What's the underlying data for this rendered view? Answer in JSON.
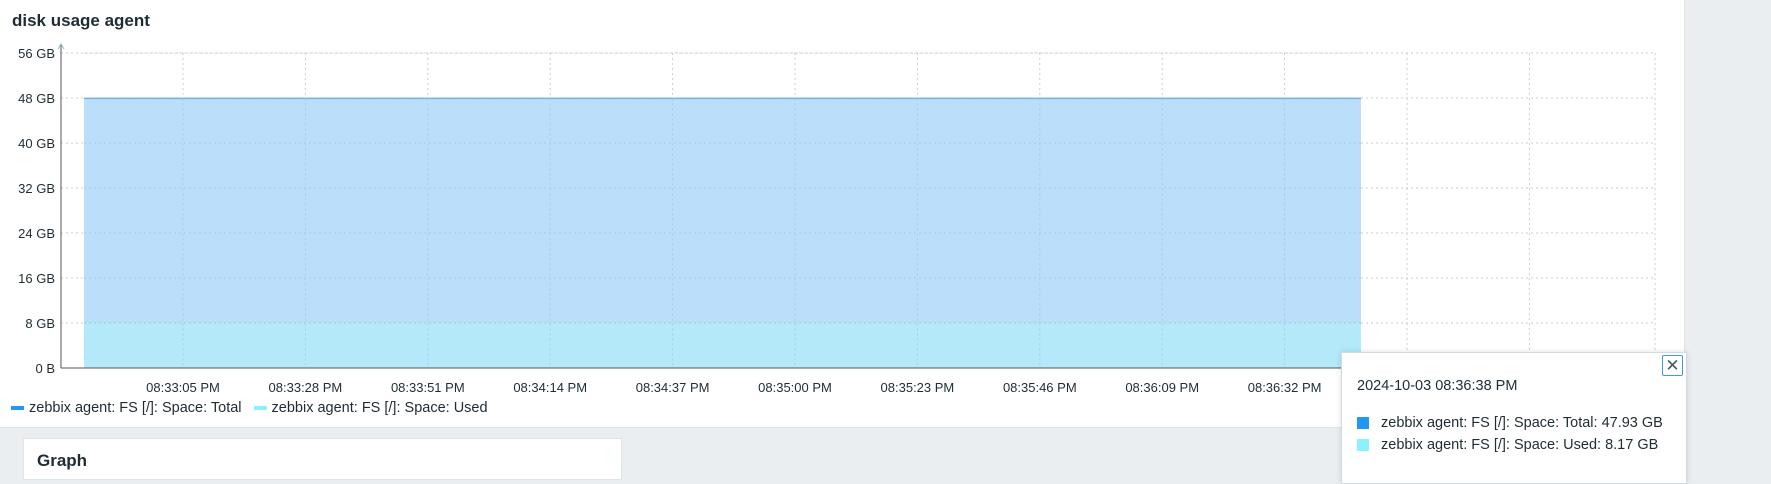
{
  "widget": {
    "title": "disk usage agent"
  },
  "chart_data": {
    "type": "area",
    "x_tick_labels": [
      "08:33:05 PM",
      "08:33:28 PM",
      "08:33:51 PM",
      "08:34:14 PM",
      "08:34:37 PM",
      "08:35:00 PM",
      "08:35:23 PM",
      "08:35:46 PM",
      "08:36:09 PM",
      "08:36:32 PM"
    ],
    "y_tick_labels": [
      "0 B",
      "8 GB",
      "16 GB",
      "24 GB",
      "32 GB",
      "40 GB",
      "48 GB",
      "56 GB"
    ],
    "y_ticks": [
      0,
      8,
      16,
      24,
      32,
      40,
      48,
      56
    ],
    "ylim": [
      0,
      56
    ],
    "y_unit": "GB",
    "grid": true,
    "series": [
      {
        "name": "zebbix agent: FS [/]: Space: Total",
        "value": 47.93,
        "color": "#2196f3",
        "fill": "#bbdefb"
      },
      {
        "name": "zebbix agent: FS [/]: Space: Used",
        "value": 8.17,
        "color": "#8cf1fb",
        "fill": "#b3e9f8"
      }
    ]
  },
  "legend": [
    {
      "label": "zebbix agent: FS [/]: Space: Total",
      "color": "#2196f3"
    },
    {
      "label": "zebbix agent: FS [/]: Space: Used",
      "color": "#8cf1fb"
    }
  ],
  "tooltip": {
    "timestamp": "2024-10-03 08:36:38 PM",
    "rows": [
      {
        "label": "zebbix agent: FS [/]: Space: Total: 47.93 GB",
        "color": "#2196f3"
      },
      {
        "label": "zebbix agent: FS [/]: Space: Used: 8.17 GB",
        "color": "#8cf1fb"
      }
    ],
    "close_icon": "close-icon"
  },
  "panel_below": {
    "title": "Graph"
  }
}
